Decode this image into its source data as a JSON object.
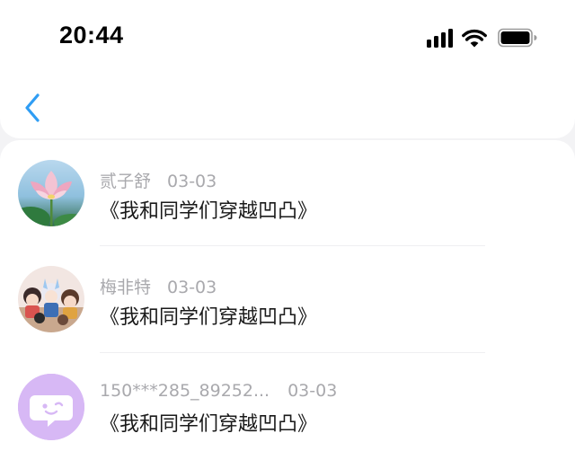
{
  "status_bar": {
    "time": "20:44",
    "icons": [
      "signal-icon",
      "wifi-icon",
      "battery-icon"
    ]
  },
  "nav": {
    "back_icon": "chevron-left-icon",
    "accent_color": "#2f9df4"
  },
  "comments": [
    {
      "user": "贰子舒",
      "date": "03-03",
      "work_title": "《我和同学们穿越凹凸》",
      "avatar": "lotus-photo-avatar"
    },
    {
      "user": "梅非特",
      "date": "03-03",
      "work_title": "《我和同学们穿越凹凸》",
      "avatar": "anime-characters-avatar"
    },
    {
      "user": "150***285_89252...",
      "date": "03-03",
      "work_title": "《我和同学们穿越凹凸》",
      "avatar": "default-chat-bubble-avatar",
      "avatar_color": "#d7b8f5"
    }
  ]
}
